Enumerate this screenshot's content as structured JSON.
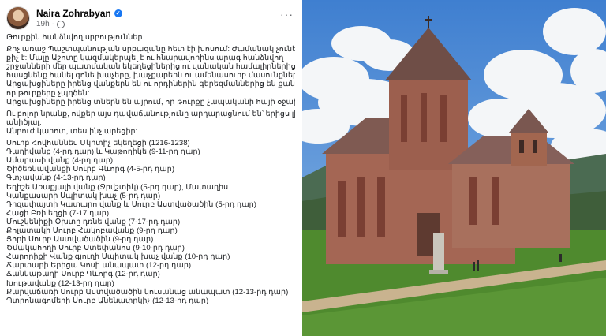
{
  "post": {
    "author": "Naira Zohrabyan",
    "time": "19h",
    "title": "Թուրքին հանձնվող սրբություններ",
    "paragraph1": [
      "Քիչ առաջ Պաշտպանության սրբազանը հետ էի խոսում: Ժամանակ չունենք, ժամանակը",
      "քիչ է: Մալը Աշոտը կազմակերպել է ու հնարավորինս արագ հանձնվող",
      "շրջանների մեր պատմական եկեղեցիներից ու վանական համալիրներից պիտի",
      "հասցնենք հանել գոնե խաչերը, խաչքարերն ու ամենասուրբ մասունքները:",
      "Արցախցիները իրենց վանքերն են ու որդիներին գերեզմաններից են քանդում-հանում,",
      "որ թուրքերը չպղծեն:",
      "Արցախցիները իրենց տներն են այրում, որ թուրքը չապականի հայի օջախը:"
    ],
    "paragraph2": [
      "Ու բոլոր նրանք, ովքեր այս դավաճանությունը արդարացնում են՝ երիցս լինեք",
      "անիծյալ:",
      "Անբուժ կարոտ, տես ինչ արեցիր:"
    ],
    "list": [
      "Սուրբ Հովհաննես Մկրտիչ եկեղեցի (1216-1238)",
      "Դադիվանք (4-րդ դար) և Կաթողիկե (9-11-րդ դար)",
      "Ամարասի վանք (4-րդ դար)",
      "Ծիծեռնավանքի Սուրբ Գևորգ (4-5-րդ դար)",
      "Գտչավանք (4-13-րդ դար)",
      "Եղիշե Առաքյալի վանք (Ջրվշտիկ) (5-րդ դար), Մատաղիս",
      "Կանքասարի Սպիտակ խաչ (5-րդ դար)",
      "Դիզափայտի Կատարո վանք և Սուրբ Աստվածածին (5-րդ դար)",
      "Հացի Բռի եղցի (7-17 դար)",
      "Մուշկենիքի Օխտը դռնե վանք (7-17-րդ դար)",
      "Քոլատակի Սուրբ Հակոբավանք (9-րդ դար)",
      "Ցորի Սուրբ Աստվածածին (9-րդ դար)",
      "Ծմակահողի Սուրբ Ստեփանոս (9-10-րդ դար)",
      "Հարորիքի Վանք գյուղի Սպիտակ խաչ վանք (10-րդ դար)",
      "Ճարտարի Երիցա Կոսի անապատ (12-րդ դար)",
      "Ճանկաթաղի Սուրբ Գևորգ (12-րդ դար)",
      "Խութավանք (12-13-րդ դար)",
      "Քարվաճառի Սուրբ Աստվածածին կուսանաց անապատ (12-13-րդ դար)",
      "Պտրոնագոմերի Սուրբ Անենափրկիչ (12-13-րդ դար)"
    ]
  },
  "photo": {
    "alt": "Armenian stone monastery church on a green lawn"
  },
  "colors": {
    "sky": "#4f8fd9",
    "cloud": "#f4f6f8",
    "grass": "#4f8a2e",
    "stone": "#a46654",
    "roof": "#7f5a52",
    "verified": "#1877f2"
  }
}
